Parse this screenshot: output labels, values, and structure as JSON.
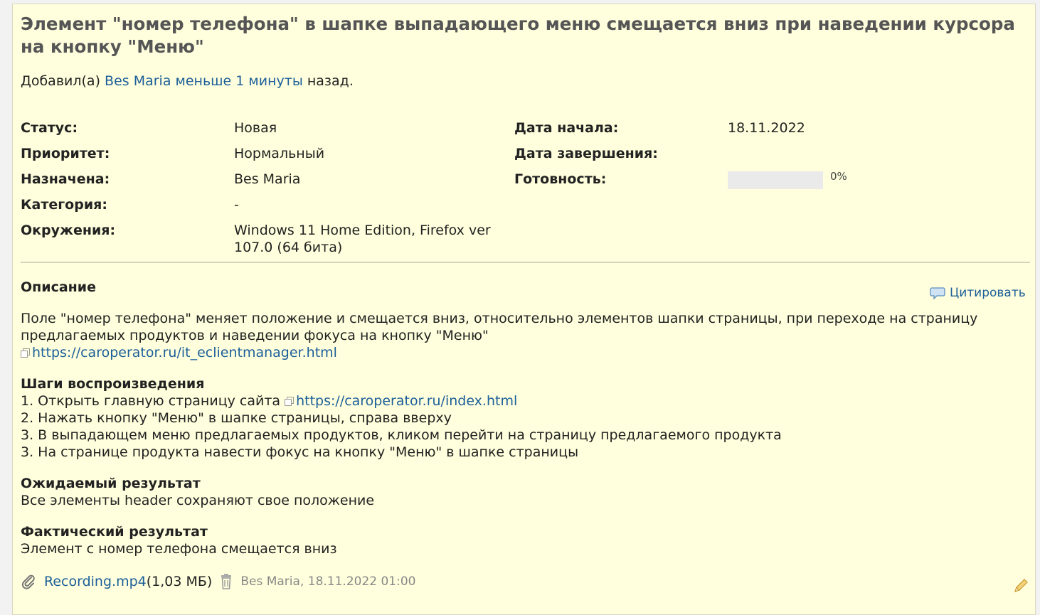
{
  "issue": {
    "title": "Элемент \"номер телефона\" в шапке выпадающего меню смещается вниз при наведении курсора на кнопку \"Меню\"",
    "added_prefix": "Добавил(а) ",
    "author": "Bes Maria",
    "added_time": "меньше 1 минуты",
    "added_suffix": " назад."
  },
  "attributes": {
    "status_label": "Статус:",
    "status_value": "Новая",
    "priority_label": "Приоритет:",
    "priority_value": "Нормальный",
    "assigned_label": "Назначена:",
    "assigned_value": "Bes Maria",
    "category_label": "Категория:",
    "category_value": "-",
    "env_label": "Окружения:",
    "env_value_line1": "Windows 11 Home Edition, Firefox ver",
    "env_value_line2": "107.0 (64 бита)",
    "start_label": "Дата начала:",
    "start_value": "18.11.2022",
    "due_label": "Дата завершения:",
    "due_value": "",
    "done_label": "Готовность:",
    "done_percent": "0%",
    "done_fraction": 0
  },
  "description": {
    "heading": "Описание",
    "quote_label": "Цитировать",
    "intro_line1": "Поле \"номер телефона\" меняет положение и смещается вниз, относительно элементов шапки страницы, при переходе на страницу",
    "intro_line2": "предлагаемых продуктов и наведении фокуса на кнопку \"Меню\"",
    "intro_link": "https://caroperator.ru/it_eclientmanager.html",
    "steps_heading": "Шаги воспроизведения",
    "step1_text": "1. Открыть главную страницу сайта ",
    "step1_link": "https://caroperator.ru/index.html",
    "step2": "2. Нажать кнопку \"Меню\" в шапке страницы, справа вверху",
    "step3": "3. В выпадающем меню предлагаемых продуктов, кликом перейти на страницу предлагаемого продукта",
    "step4": "3. На странице продукта навести фокус на кнопку \"Меню\" в шапке страницы",
    "expected_heading": "Ожидаемый результат",
    "expected_text": "Все элементы header сохраняют свое положение",
    "actual_heading": "Фактический результат",
    "actual_text": "Элемент с номер телефона смещается вниз"
  },
  "attachment": {
    "filename": "Recording.mp4",
    "size": " (1,03 МБ)",
    "meta": "Bes Maria, 18.11.2022 01:00"
  },
  "colors": {
    "issue_bg": "#ffffdd",
    "link": "#1c5f99",
    "title": "#555555"
  }
}
